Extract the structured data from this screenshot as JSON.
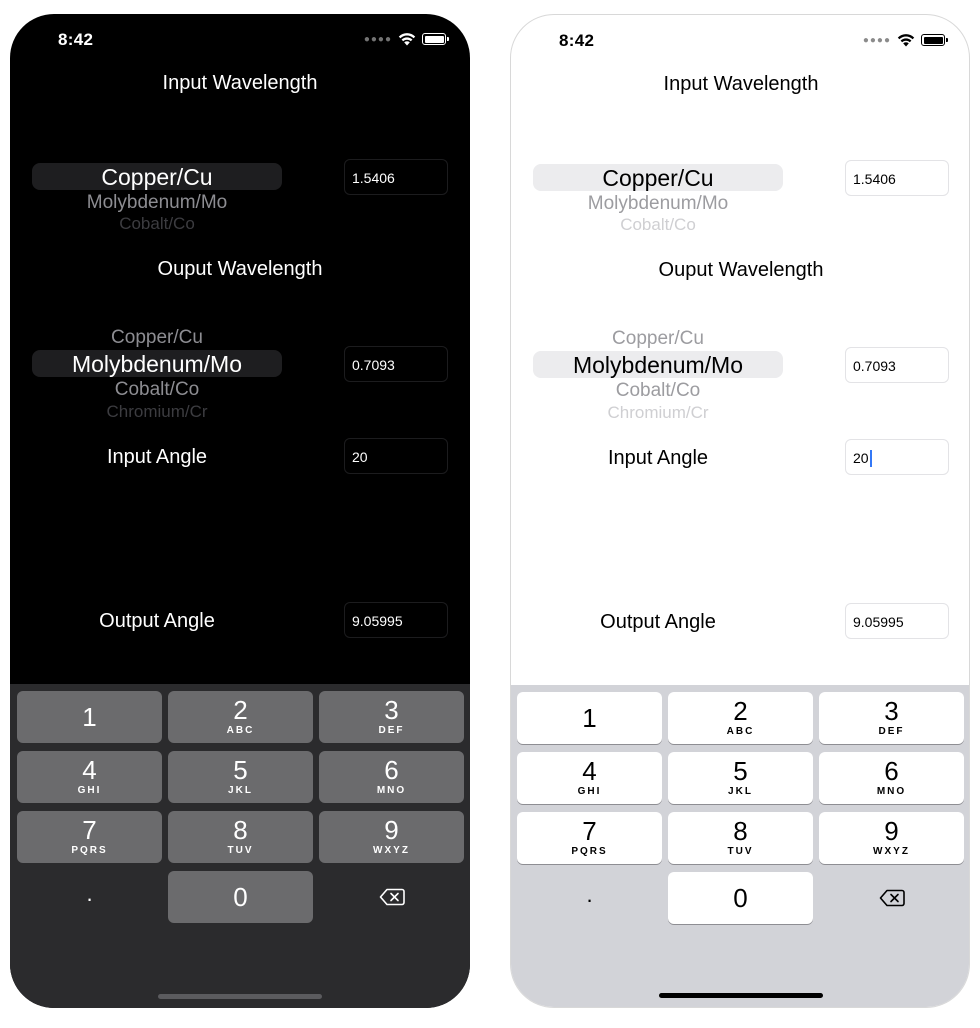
{
  "status": {
    "time": "8:42"
  },
  "titles": {
    "input_wavelength": "Input Wavelength",
    "output_wavelength": "Ouput Wavelength",
    "input_angle": "Input Angle",
    "output_angle": "Output Angle"
  },
  "input_picker": {
    "selected": "Copper/Cu",
    "below1": "Molybdenum/Mo",
    "below2": "Cobalt/Co"
  },
  "output_picker": {
    "above1": "Copper/Cu",
    "selected": "Molybdenum/Mo",
    "below1": "Cobalt/Co",
    "below2": "Chromium/Cr"
  },
  "fields": {
    "input_wavelength_value": "1.5406",
    "output_wavelength_value": "0.7093",
    "input_angle_value": "20",
    "output_angle_value": "9.05995"
  },
  "keypad": {
    "k1": "1",
    "k1_letters": "",
    "k2": "2",
    "k2_letters": "ABC",
    "k3": "3",
    "k3_letters": "DEF",
    "k4": "4",
    "k4_letters": "GHI",
    "k5": "5",
    "k5_letters": "JKL",
    "k6": "6",
    "k6_letters": "MNO",
    "k7": "7",
    "k7_letters": "PQRS",
    "k8": "8",
    "k8_letters": "TUV",
    "k9": "9",
    "k9_letters": "WXYZ",
    "decimal": ".",
    "k0": "0",
    "backspace_icon": "delete-backward-icon"
  },
  "theme": {
    "dark_background": "#000000",
    "light_background": "#ffffff",
    "caret_color": "#3478f6"
  }
}
